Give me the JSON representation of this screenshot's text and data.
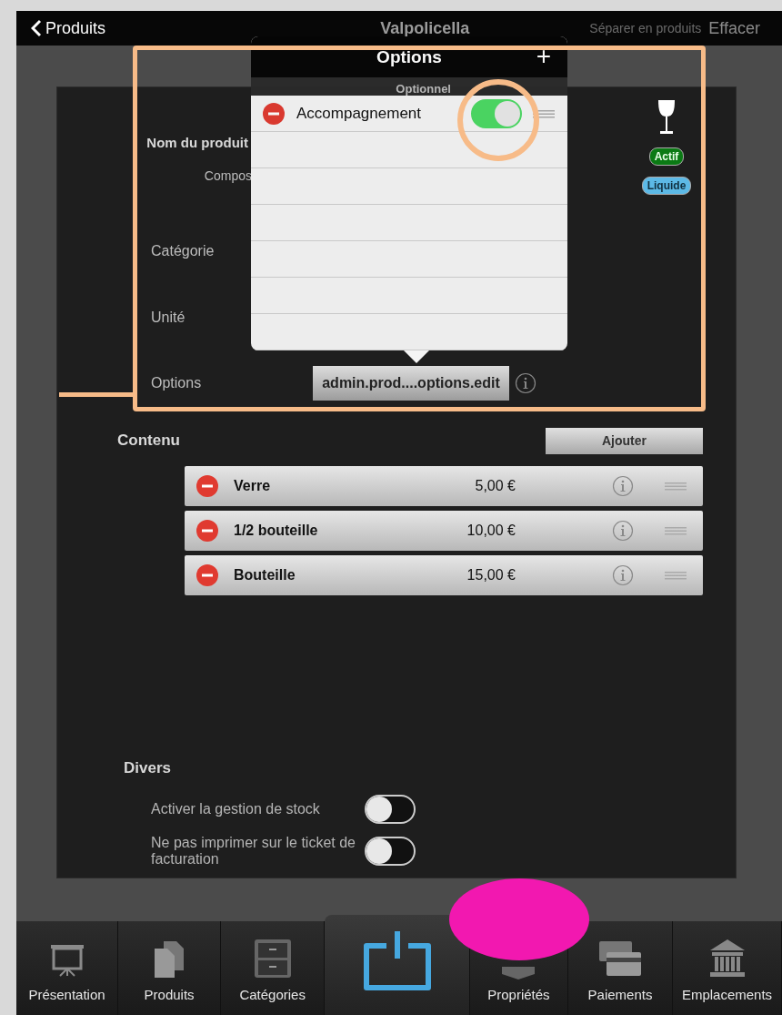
{
  "nav": {
    "back": "Produits",
    "title": "Valpolicella",
    "actions": [
      {
        "label": "Séparer en produits",
        "dim": true
      },
      {
        "label": "Effacer",
        "dim": false
      }
    ]
  },
  "product": {
    "name_label": "Nom du produit",
    "composite_label": "Compos",
    "fields": [
      {
        "label": "Catégorie"
      },
      {
        "label": "Unité"
      }
    ],
    "options_label": "Options",
    "options_button": "admin.prod....options.edit",
    "badges": [
      {
        "label": "Actif",
        "color": "#0b7a14"
      },
      {
        "label": "Liquide",
        "color": "#5cb9e6"
      }
    ]
  },
  "popover": {
    "title": "Options",
    "add": "+",
    "section": "Optionnel",
    "items": [
      {
        "label": "Accompagnement",
        "on": true
      }
    ]
  },
  "contenu": {
    "title": "Contenu",
    "add": "Ajouter",
    "rows": [
      {
        "name": "Verre",
        "price": "5,00 €"
      },
      {
        "name": "1/2 bouteille",
        "price": "10,00 €"
      },
      {
        "name": "Bouteille",
        "price": "15,00 €"
      }
    ]
  },
  "divers": {
    "title": "Divers",
    "settings": [
      {
        "label": "Activer la gestion de stock",
        "on": false
      },
      {
        "label": "Ne pas imprimer sur le ticket de facturation",
        "on": false
      }
    ]
  },
  "tabs": [
    {
      "kind": "presentation",
      "label": "Présentation"
    },
    {
      "kind": "documents",
      "label": "Produits"
    },
    {
      "kind": "cabinet",
      "label": "Catégories"
    },
    {
      "kind": "power"
    },
    {
      "kind": "box",
      "label": "Propriétés"
    },
    {
      "kind": "cards",
      "label": "Paiements"
    },
    {
      "kind": "bank",
      "label": "Emplacements"
    }
  ],
  "annotations": [
    {
      "kind": "frame",
      "color": "#f7bb88"
    },
    {
      "kind": "circle",
      "color": "#f7bb88"
    },
    {
      "kind": "blob",
      "color": "#f218b0"
    }
  ]
}
